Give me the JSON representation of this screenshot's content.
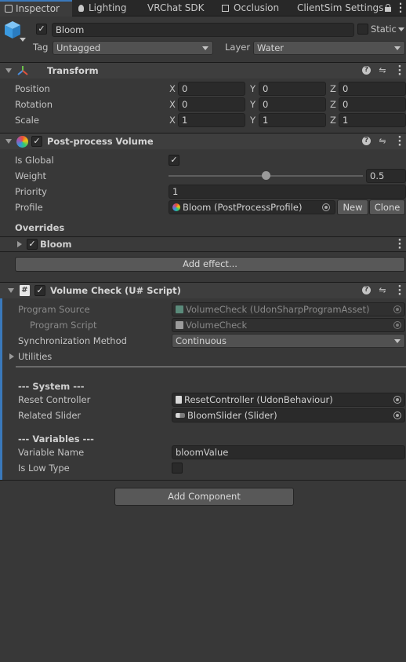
{
  "tabs": [
    {
      "label": "Inspector",
      "active": true
    },
    {
      "label": "Lighting"
    },
    {
      "label": "VRChat SDK"
    },
    {
      "label": "Occlusion"
    },
    {
      "label": "ClientSim Settings"
    }
  ],
  "object": {
    "name": "Bloom",
    "static_label": "Static",
    "tag_label": "Tag",
    "tag_value": "Untagged",
    "layer_label": "Layer",
    "layer_value": "Water"
  },
  "transform": {
    "title": "Transform",
    "rows": [
      {
        "label": "Position",
        "x": "0",
        "y": "0",
        "z": "0"
      },
      {
        "label": "Rotation",
        "x": "0",
        "y": "0",
        "z": "0"
      },
      {
        "label": "Scale",
        "x": "1",
        "y": "1",
        "z": "1"
      }
    ],
    "axes": [
      "X",
      "Y",
      "Z"
    ]
  },
  "ppv": {
    "title": "Post-process Volume",
    "is_global_label": "Is Global",
    "weight_label": "Weight",
    "weight_value": "0.5",
    "weight_fraction": 0.5,
    "priority_label": "Priority",
    "priority_value": "1",
    "profile_label": "Profile",
    "profile_value": "Bloom (PostProcessProfile)",
    "new_label": "New",
    "clone_label": "Clone",
    "overrides_label": "Overrides",
    "bloom_label": "Bloom",
    "add_effect_label": "Add effect..."
  },
  "udon": {
    "title": "Volume Check (U# Script)",
    "program_source_label": "Program Source",
    "program_source_value": "VolumeCheck (UdonSharpProgramAsset)",
    "program_script_label": "Program Script",
    "program_script_value": "VolumeCheck",
    "sync_label": "Synchronization Method",
    "sync_value": "Continuous",
    "utilities_label": "Utilities",
    "system_header": "--- System ---",
    "reset_label": "Reset Controller",
    "reset_value": "ResetController (UdonBehaviour)",
    "slider_label": "Related Slider",
    "slider_value": "BloomSlider (Slider)",
    "variables_header": "--- Variables ---",
    "varname_label": "Variable Name",
    "varname_value": "bloomValue",
    "lowtype_label": "Is Low Type"
  },
  "add_component_label": "Add Component",
  "colors": {
    "accent": "#3a79bb",
    "background": "#383838",
    "header": "#3e3e3e"
  }
}
